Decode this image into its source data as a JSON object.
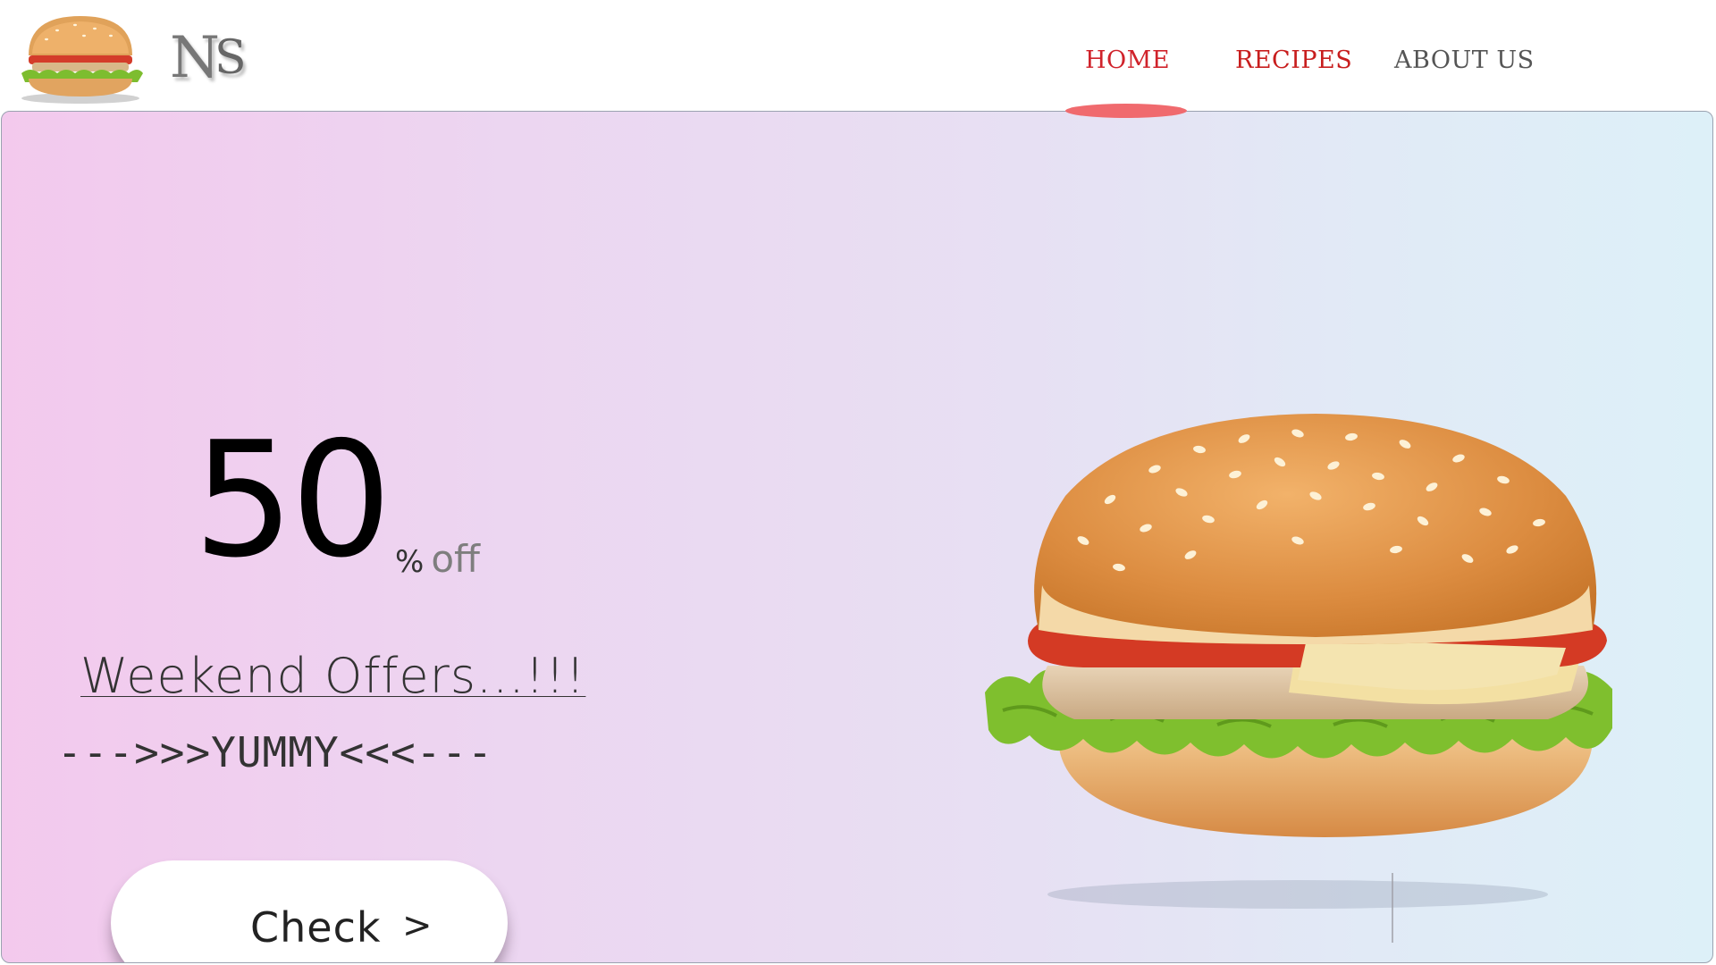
{
  "header": {
    "logo_text_1": "N",
    "logo_text_2": "S",
    "nav": [
      {
        "label": "HOME",
        "active": true
      },
      {
        "label": "RECIPES",
        "active": false
      },
      {
        "label": "ABOUT US",
        "active": false
      }
    ]
  },
  "hero": {
    "discount_number": "50",
    "discount_percent": "%",
    "discount_off": "off",
    "headline": "Weekend Offers...!!!",
    "tagline": "--->>>YUMMY<<<---",
    "cta_label": "Check",
    "cta_arrow": ">"
  },
  "colors": {
    "active_nav": "#d0232b",
    "nav_indicator": "#f06a6e",
    "hero_gradient_start": "#f3c9ed",
    "hero_gradient_end": "#ddf0f8"
  },
  "icons": {
    "logo_image": "burger-icon",
    "hero_image": "burger-icon"
  }
}
